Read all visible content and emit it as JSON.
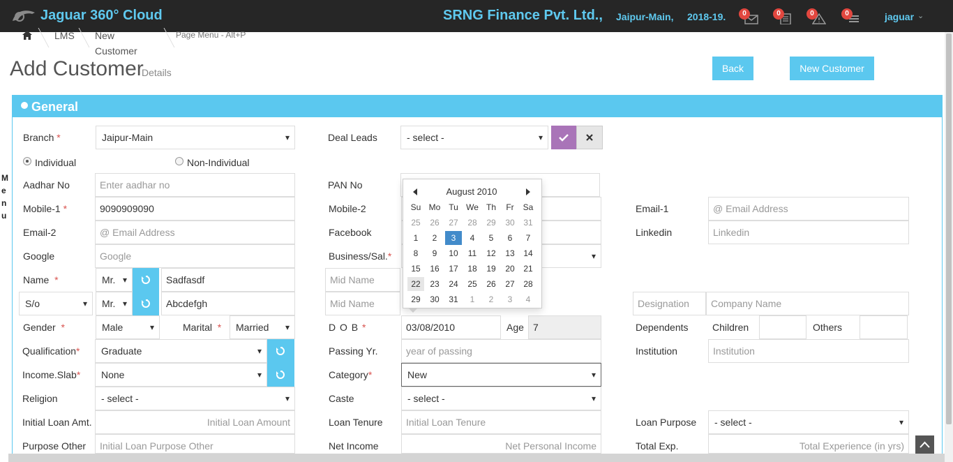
{
  "header": {
    "app_title": "Jaguar 360° Cloud",
    "company": "SRNG Finance Pvt. Ltd.,",
    "branch": "Jaipur-Main,",
    "year": "2018-19.",
    "notifications": [
      {
        "count": "0",
        "icon": "mail-icon"
      },
      {
        "count": "0",
        "icon": "document-list-icon"
      },
      {
        "count": "0",
        "icon": "warning-icon"
      },
      {
        "count": "0",
        "icon": "stack-icon"
      }
    ],
    "user": "jaguar",
    "accent_color": "#5fc9ef"
  },
  "side_menu": [
    "M",
    "e",
    "n",
    "u"
  ],
  "breadcrumb": {
    "home_icon": "home-icon",
    "items": [
      "LMS",
      "New Customer"
    ],
    "page_menu_hint": "Page Menu - Alt+P"
  },
  "page": {
    "title": "Add Customer",
    "subtitle": "Details",
    "back_label": "Back",
    "new_customer_label": "New Customer"
  },
  "panel": {
    "title": "General"
  },
  "form": {
    "branch": {
      "label": "Branch",
      "value": "Jaipur-Main"
    },
    "deal_leads": {
      "label": "Deal Leads",
      "value": "- select -"
    },
    "entity_type": {
      "individual": "Individual",
      "non_individual": "Non-Individual",
      "selected": "Individual"
    },
    "aadhar": {
      "label": "Aadhar No",
      "placeholder": "Enter aadhar no"
    },
    "pan": {
      "label": "PAN No",
      "value": ""
    },
    "mobile1": {
      "label": "Mobile-1",
      "value": "9090909090"
    },
    "mobile2": {
      "label": "Mobile-2",
      "value": ""
    },
    "email1": {
      "label": "Email-1",
      "placeholder": "@ Email Address"
    },
    "email2": {
      "label": "Email-2",
      "placeholder": "@ Email Address"
    },
    "facebook": {
      "label": "Facebook",
      "value": ""
    },
    "linkedin": {
      "label": "Linkedin",
      "placeholder": "Linkedin"
    },
    "google": {
      "label": "Google",
      "placeholder": "Google"
    },
    "business": {
      "label": "Business/Sal.",
      "value": ""
    },
    "name": {
      "label": "Name",
      "title": "Mr.",
      "first": "Sadfasdf",
      "mid_placeholder": "Mid Name"
    },
    "relation": {
      "type": "S/o",
      "title": "Mr.",
      "first": "Abcdefgh",
      "mid_placeholder": "Mid Name",
      "designation_placeholder": "Designation",
      "company_placeholder": "Company Name"
    },
    "gender": {
      "label": "Gender",
      "value": "Male"
    },
    "marital": {
      "label": "Marital",
      "value": "Married"
    },
    "dob": {
      "label": "D O B",
      "value": "03/08/2010"
    },
    "age": {
      "label": "Age",
      "value": "7"
    },
    "dependents": {
      "label": "Dependents",
      "children_label": "Children",
      "others_label": "Others"
    },
    "qualification": {
      "label": "Qualification",
      "value": "Graduate"
    },
    "passing_year": {
      "label": "Passing Yr.",
      "placeholder": "year of passing"
    },
    "institution": {
      "label": "Institution",
      "placeholder": "Institution"
    },
    "income_slab": {
      "label": "Income.Slab",
      "value": "None"
    },
    "category": {
      "label": "Category",
      "value": "New"
    },
    "religion": {
      "label": "Religion",
      "value": "- select -"
    },
    "caste": {
      "label": "Caste",
      "value": "- select -"
    },
    "initial_loan": {
      "label": "Initial Loan Amt.",
      "placeholder": "Initial Loan Amount"
    },
    "loan_tenure": {
      "label": "Loan Tenure",
      "placeholder": "Initial Loan Tenure"
    },
    "loan_purpose": {
      "label": "Loan Purpose",
      "value": "- select -"
    },
    "purpose_other": {
      "label": "Purpose Other",
      "placeholder": "Initial Loan Purpose Other"
    },
    "net_income": {
      "label": "Net Income",
      "placeholder": "Net Personal Income"
    },
    "total_exp": {
      "label": "Total Exp.",
      "placeholder": "Total Experience (in yrs)"
    }
  },
  "datepicker": {
    "title": "August 2010",
    "weekdays": [
      "Su",
      "Mo",
      "Tu",
      "We",
      "Th",
      "Fr",
      "Sa"
    ],
    "weeks": [
      [
        "25",
        "26",
        "27",
        "28",
        "29",
        "30",
        "31"
      ],
      [
        "1",
        "2",
        "3",
        "4",
        "5",
        "6",
        "7"
      ],
      [
        "8",
        "9",
        "10",
        "11",
        "12",
        "13",
        "14"
      ],
      [
        "15",
        "16",
        "17",
        "18",
        "19",
        "20",
        "21"
      ],
      [
        "22",
        "23",
        "24",
        "25",
        "26",
        "27",
        "28"
      ],
      [
        "29",
        "30",
        "31",
        "1",
        "2",
        "3",
        "4"
      ]
    ],
    "selected": "3",
    "highlighted": "22"
  }
}
